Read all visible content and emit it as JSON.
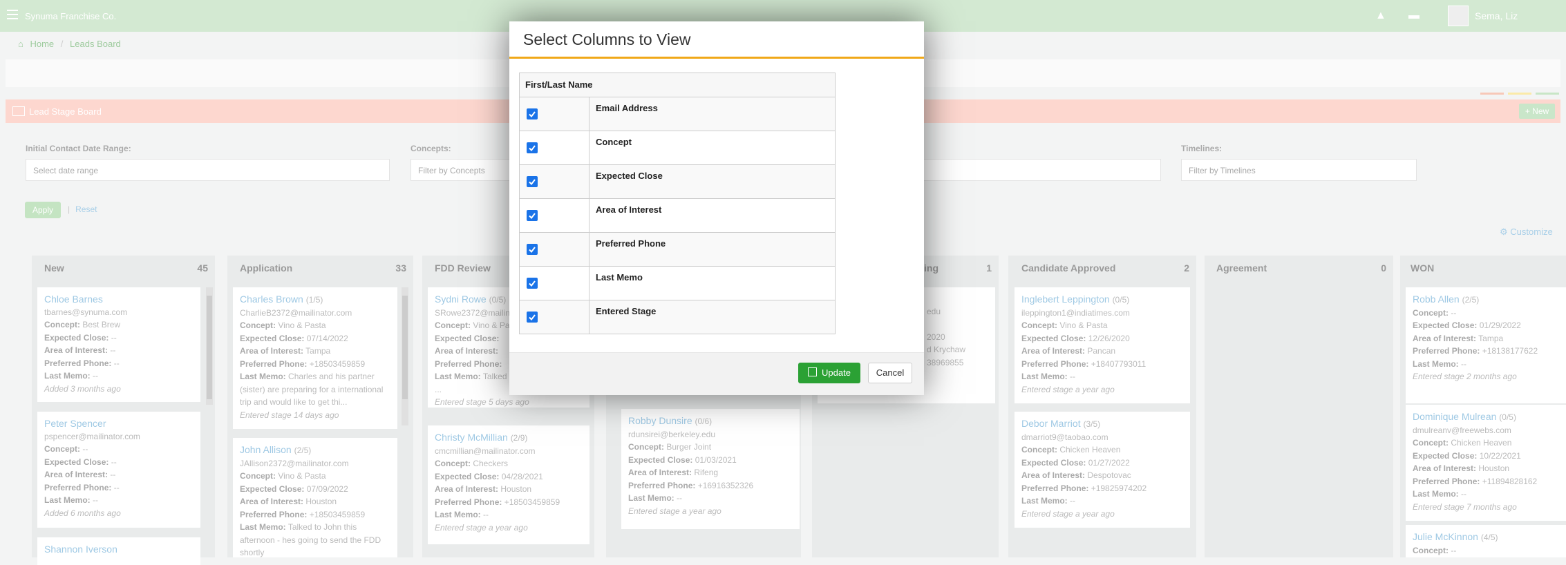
{
  "app": {
    "brand": "Synuma Franchise Co.",
    "user": "Sema, Liz"
  },
  "breadcrumb": {
    "home": "Home",
    "sep": "/",
    "current": "Leads Board"
  },
  "stage_board": {
    "title": "Lead Stage Board",
    "new_label": "New"
  },
  "filters": {
    "date_label": "Initial Contact Date Range:",
    "date_placeholder": "Select date range",
    "concepts_label": "Concepts:",
    "concepts_placeholder": "Filter by Concepts",
    "timelines_label": "Timelines:",
    "timelines_placeholder": "Filter by Timelines",
    "apply": "Apply",
    "sep": "|",
    "reset": "Reset"
  },
  "customize": "Customize",
  "colors": {
    "accent": "#f0a818",
    "update": "#2ba134",
    "checkbox": "#1a73e8"
  },
  "columns": [
    {
      "title": "New",
      "count": "45"
    },
    {
      "title": "Application",
      "count": "33"
    },
    {
      "title": "FDD Review",
      "count": ""
    },
    {
      "title": "ing",
      "count": "1"
    },
    {
      "title": "Candidate Approved",
      "count": "2"
    },
    {
      "title": "Agreement",
      "count": "0"
    },
    {
      "title": "WON",
      "count": ""
    }
  ],
  "cards": {
    "chloe": {
      "name": "Chloe Barnes",
      "email": "tbarnes@synuma.com",
      "concept": "Best Brew",
      "close": "--",
      "area": "--",
      "phone": "--",
      "memo": "--",
      "age": "Added 3 months ago"
    },
    "peter": {
      "name": "Peter Spencer",
      "email": "pspencer@mailinator.com",
      "concept": "--",
      "close": "--",
      "area": "--",
      "phone": "--",
      "memo": "--",
      "age": "Added 6 months ago"
    },
    "shannon": {
      "name": "Shannon Iverson"
    },
    "charles": {
      "name": "Charles Brown",
      "score": "(1/5)",
      "email": "CharlieB2372@mailinator.com",
      "concept": "Vino & Pasta",
      "close": "07/14/2022",
      "area": "Tampa",
      "phone": "+18503459859",
      "memo": "Charles and his partner (sister) are preparing for a international trip and would like to get thi...",
      "age": "Entered stage 14 days ago"
    },
    "john": {
      "name": "John Allison",
      "score": "(2/5)",
      "email": "JAllison2372@mailinator.com",
      "concept": "Vino & Pasta",
      "close": "07/09/2022",
      "area": "Houston",
      "phone": "+18503459859",
      "memo": "Talked to John this afternoon - hes going to send the FDD shortly"
    },
    "sydni": {
      "name": "Sydni Rowe",
      "score": "(0/5)",
      "email": "SRowe2372@mailinator.com",
      "concept": "Vino & Pasta",
      "memo": "Talked ... ll be visiting the ...",
      "age": "Entered stage 5 days ago"
    },
    "christy": {
      "name": "Christy McMillian",
      "score": "(2/9)",
      "email": "cmcmillian@mailinator.com",
      "concept": "Checkers",
      "close": "04/28/2021",
      "area": "Houston",
      "phone": "+18503459859",
      "memo": "--",
      "age": "Entered stage a year ago"
    },
    "robby": {
      "name": "Robby Dunsire",
      "score": "(0/6)",
      "email": "rdunsirei@berkeley.edu",
      "concept": "Burger Joint",
      "close": "01/03/2021",
      "area": "Rifeng",
      "phone": "+16916352326",
      "memo": "--",
      "age": "Entered stage a year ago"
    },
    "partial": {
      "email": "edu",
      "close": "2020",
      "memo": "d Krychaw",
      "phone": "38969855"
    },
    "inglebert": {
      "name": "Inglebert Leppington",
      "score": "(0/5)",
      "email": "ileppington1@indiatimes.com",
      "concept": "Vino & Pasta",
      "close": "12/26/2020",
      "area": "Pancan",
      "phone": "+18407793011",
      "memo": "--",
      "age": "Entered stage a year ago"
    },
    "debor": {
      "name": "Debor Marriot",
      "score": "(3/5)",
      "email": "dmarriot9@taobao.com",
      "concept": "Chicken Heaven",
      "close": "01/27/2022",
      "area": "Despotovac",
      "phone": "+19825974202",
      "memo": "--",
      "age": "Entered stage a year ago"
    },
    "robb": {
      "name": "Robb Allen",
      "score": "(2/5)",
      "concept": "--",
      "close": "01/29/2022",
      "area": "Tampa",
      "phone": "+18138177622",
      "memo": "--",
      "age": "Entered stage 2 months ago"
    },
    "dominique": {
      "name": "Dominique Mulrean",
      "score": "(0/5)",
      "email": "dmulreanv@freewebs.com",
      "concept": "Chicken Heaven",
      "close": "10/22/2021",
      "area": "Houston",
      "phone": "+11894828162",
      "memo": "--",
      "age": "Entered stage 7 months ago"
    },
    "julie": {
      "name": "Julie McKinnon",
      "score": "(4/5)",
      "concept": "--"
    }
  },
  "field_labels": {
    "concept": "Concept:",
    "close": "Expected Close:",
    "area": "Area of Interest:",
    "phone": "Preferred Phone:",
    "memo": "Last Memo:"
  },
  "modal": {
    "title": "Select Columns to View",
    "header_col": "First/Last Name",
    "options": [
      {
        "label": "Email Address",
        "checked": true
      },
      {
        "label": "Concept",
        "checked": true
      },
      {
        "label": "Expected Close",
        "checked": true
      },
      {
        "label": "Area of Interest",
        "checked": true
      },
      {
        "label": "Preferred Phone",
        "checked": true
      },
      {
        "label": "Last Memo",
        "checked": true
      },
      {
        "label": "Entered Stage",
        "checked": true
      }
    ],
    "update": "Update",
    "cancel": "Cancel"
  }
}
